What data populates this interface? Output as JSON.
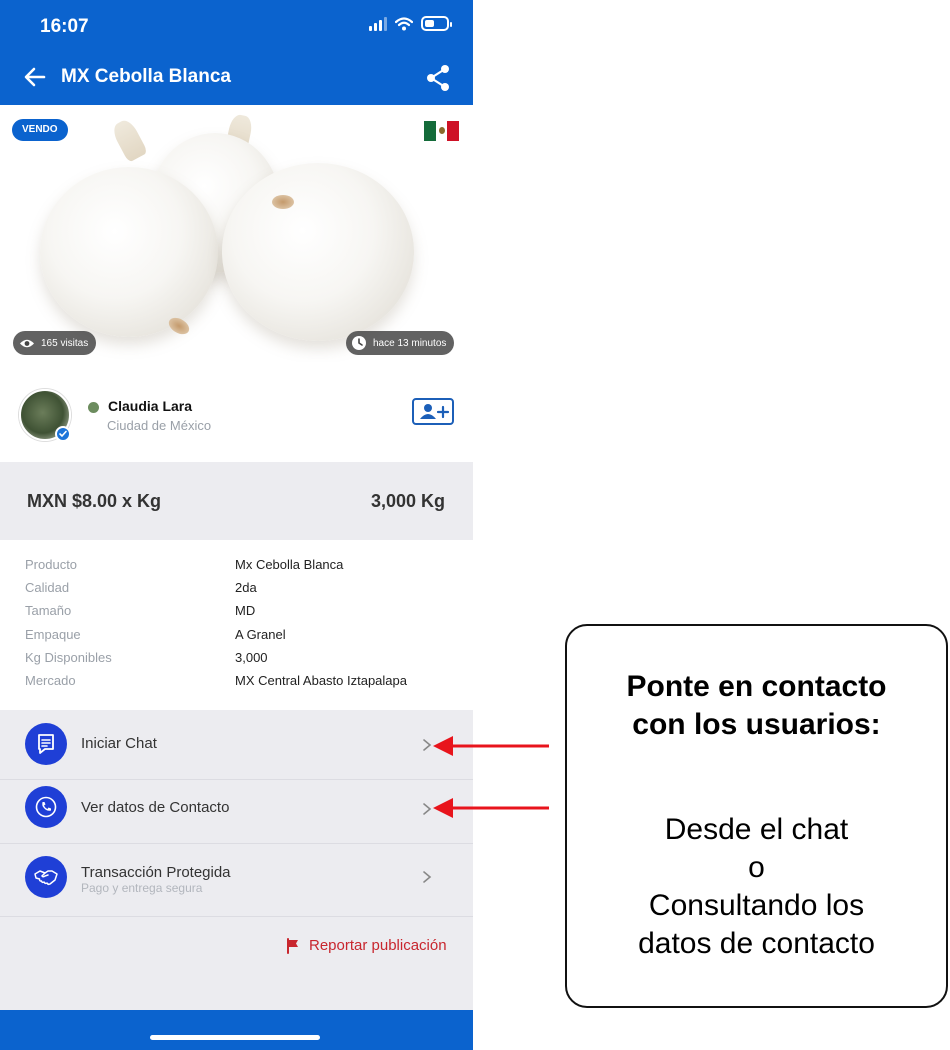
{
  "status_bar": {
    "time": "16:07"
  },
  "header": {
    "title": "MX Cebolla Blanca"
  },
  "image": {
    "badge": "VENDO",
    "visits": "165 visitas",
    "posted": "hace 13 minutos"
  },
  "seller": {
    "name": "Claudia Lara",
    "city": "Ciudad de México"
  },
  "listing": {
    "price": "MXN $8.00 x Kg",
    "quantity": "3,000 Kg"
  },
  "details": [
    {
      "label": "Producto",
      "value": "Mx Cebolla Blanca"
    },
    {
      "label": "Calidad",
      "value": "2da"
    },
    {
      "label": "Tamaño",
      "value": "MD"
    },
    {
      "label": "Empaque",
      "value": "A Granel"
    },
    {
      "label": "Kg Disponibles",
      "value": "3,000"
    },
    {
      "label": "Mercado",
      "value": "MX Central Abasto Iztapalapa"
    }
  ],
  "actions": {
    "chat": "Iniciar Chat",
    "contact": "Ver datos de Contacto",
    "transaction": "Transacción Protegida",
    "transaction_sub": "Pago y entrega segura"
  },
  "report": "Reportar publicación",
  "callout": {
    "title_line1": "Ponte en contacto",
    "title_line2": "con los usuarios:",
    "body_line1": "Desde el chat",
    "body_line2": "o",
    "body_line3": "Consultando los",
    "body_line4": "datos de contacto"
  },
  "colors": {
    "primary": "#0b63ce",
    "action_icon": "#1f3fd6",
    "report": "#c8262e",
    "arrow": "#e8141c"
  }
}
